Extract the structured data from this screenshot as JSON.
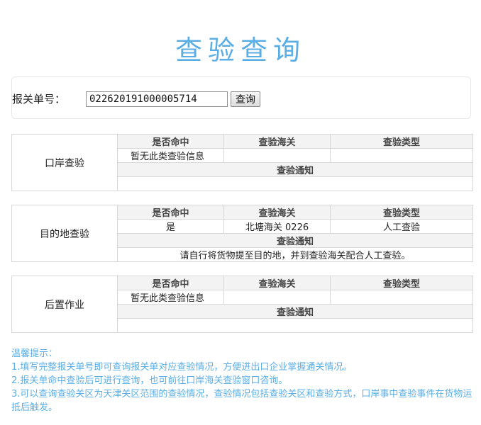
{
  "page_title": "查验查询",
  "search": {
    "label": "报关单号：",
    "value": "022620191000005714",
    "button_label": "查询"
  },
  "columns": [
    "是否命中",
    "查验海关",
    "查验类型"
  ],
  "notice_header": "查验通知",
  "sections": [
    {
      "name": "口岸查验",
      "hit": "暂无此类查验信息",
      "customs": "",
      "type": "",
      "notice": ""
    },
    {
      "name": "目的地查验",
      "hit": "是",
      "customs": "北塘海关 0226",
      "type": "人工查验",
      "notice": "请自行将货物提至目的地，并到查验海关配合人工查验。"
    },
    {
      "name": "后置作业",
      "hit": "暂无此类查验信息",
      "customs": "",
      "type": "",
      "notice": ""
    }
  ],
  "tips": {
    "title": "温馨提示：",
    "items": [
      "1.填写完整报关单号即可查询报关单对应查验情况，方便进出口企业掌握通关情况。",
      "2.报关单命中查验后可进行查询，也可前往口岸海关查验窗口咨询。",
      "3.可以查询查验关区为天津关区范围的查验情况，查验情况包括查验关区和查验方式，口岸事中查验事件在货物运抵后触发。"
    ]
  }
}
